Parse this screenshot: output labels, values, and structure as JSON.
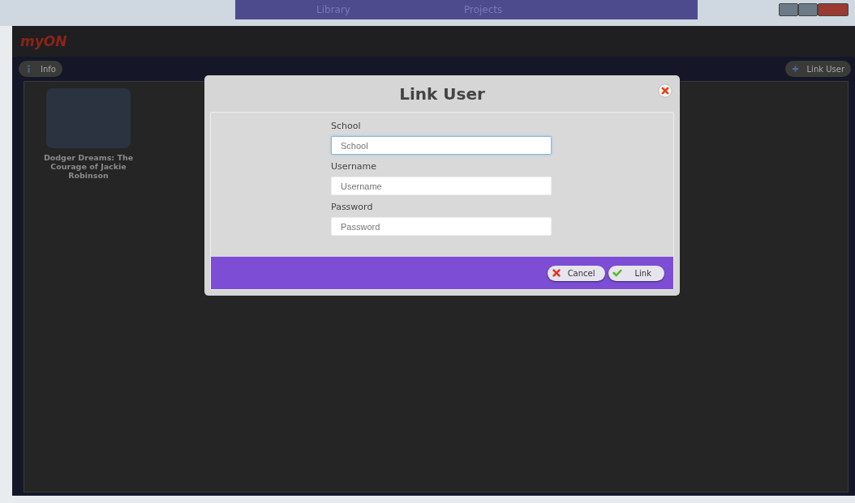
{
  "taskbar": {
    "items": [
      "Library",
      "Projects"
    ]
  },
  "app": {
    "logo": "myON"
  },
  "toolbar": {
    "info_button": "Info",
    "link_user_button": "Link User"
  },
  "books": [
    {
      "title": "Dodger Dreams: The Courage of Jackie Robinson"
    }
  ],
  "dialog": {
    "title": "Link User",
    "fields": [
      {
        "label": "School",
        "placeholder": "School",
        "focused": true
      },
      {
        "label": "Username",
        "placeholder": "Username",
        "focused": false
      },
      {
        "label": "Password",
        "placeholder": "Password",
        "focused": false
      }
    ],
    "buttons": [
      {
        "label": "Cancel",
        "kind": "cancel"
      },
      {
        "label": "Link",
        "kind": "confirm"
      }
    ]
  }
}
